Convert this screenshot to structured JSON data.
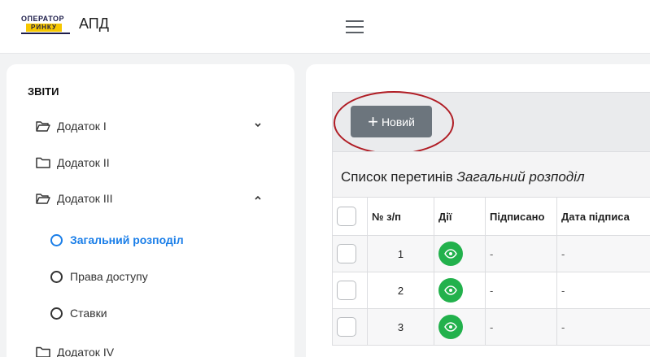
{
  "header": {
    "logo_line1": "ОПЕРАТОР",
    "logo_line2": "РИНКУ",
    "app_title": "АПД"
  },
  "sidebar": {
    "section_title": "ЗВІТИ",
    "items": [
      {
        "label": "Додаток I",
        "icon": "folder-open-icon",
        "chevron": "chevron-down-icon"
      },
      {
        "label": "Додаток II",
        "icon": "folder-icon"
      },
      {
        "label": "Додаток III",
        "icon": "folder-open-icon",
        "chevron": "chevron-up-icon"
      },
      {
        "label": "Додаток IV",
        "icon": "folder-icon"
      }
    ],
    "subitems": [
      {
        "label": "Загальний розподіл",
        "active": true
      },
      {
        "label": "Права доступу",
        "active": false
      },
      {
        "label": "Ставки",
        "active": false
      }
    ]
  },
  "toolbar": {
    "new_button_label": "Новий"
  },
  "list": {
    "title": "Список перетинів",
    "subtitle": "Загальний розподіл"
  },
  "table": {
    "columns": [
      "№ з/п",
      "Дії",
      "Підписано",
      "Дата підписа"
    ],
    "rows": [
      {
        "num": "1",
        "signed": "-",
        "signed_date": "-"
      },
      {
        "num": "2",
        "signed": "-",
        "signed_date": "-"
      },
      {
        "num": "3",
        "signed": "-",
        "signed_date": "-"
      }
    ]
  },
  "colors": {
    "accent_blue": "#1a7ee8",
    "action_green": "#22b14c",
    "button_gray": "#6c757d",
    "highlight_red": "#b01c24"
  }
}
